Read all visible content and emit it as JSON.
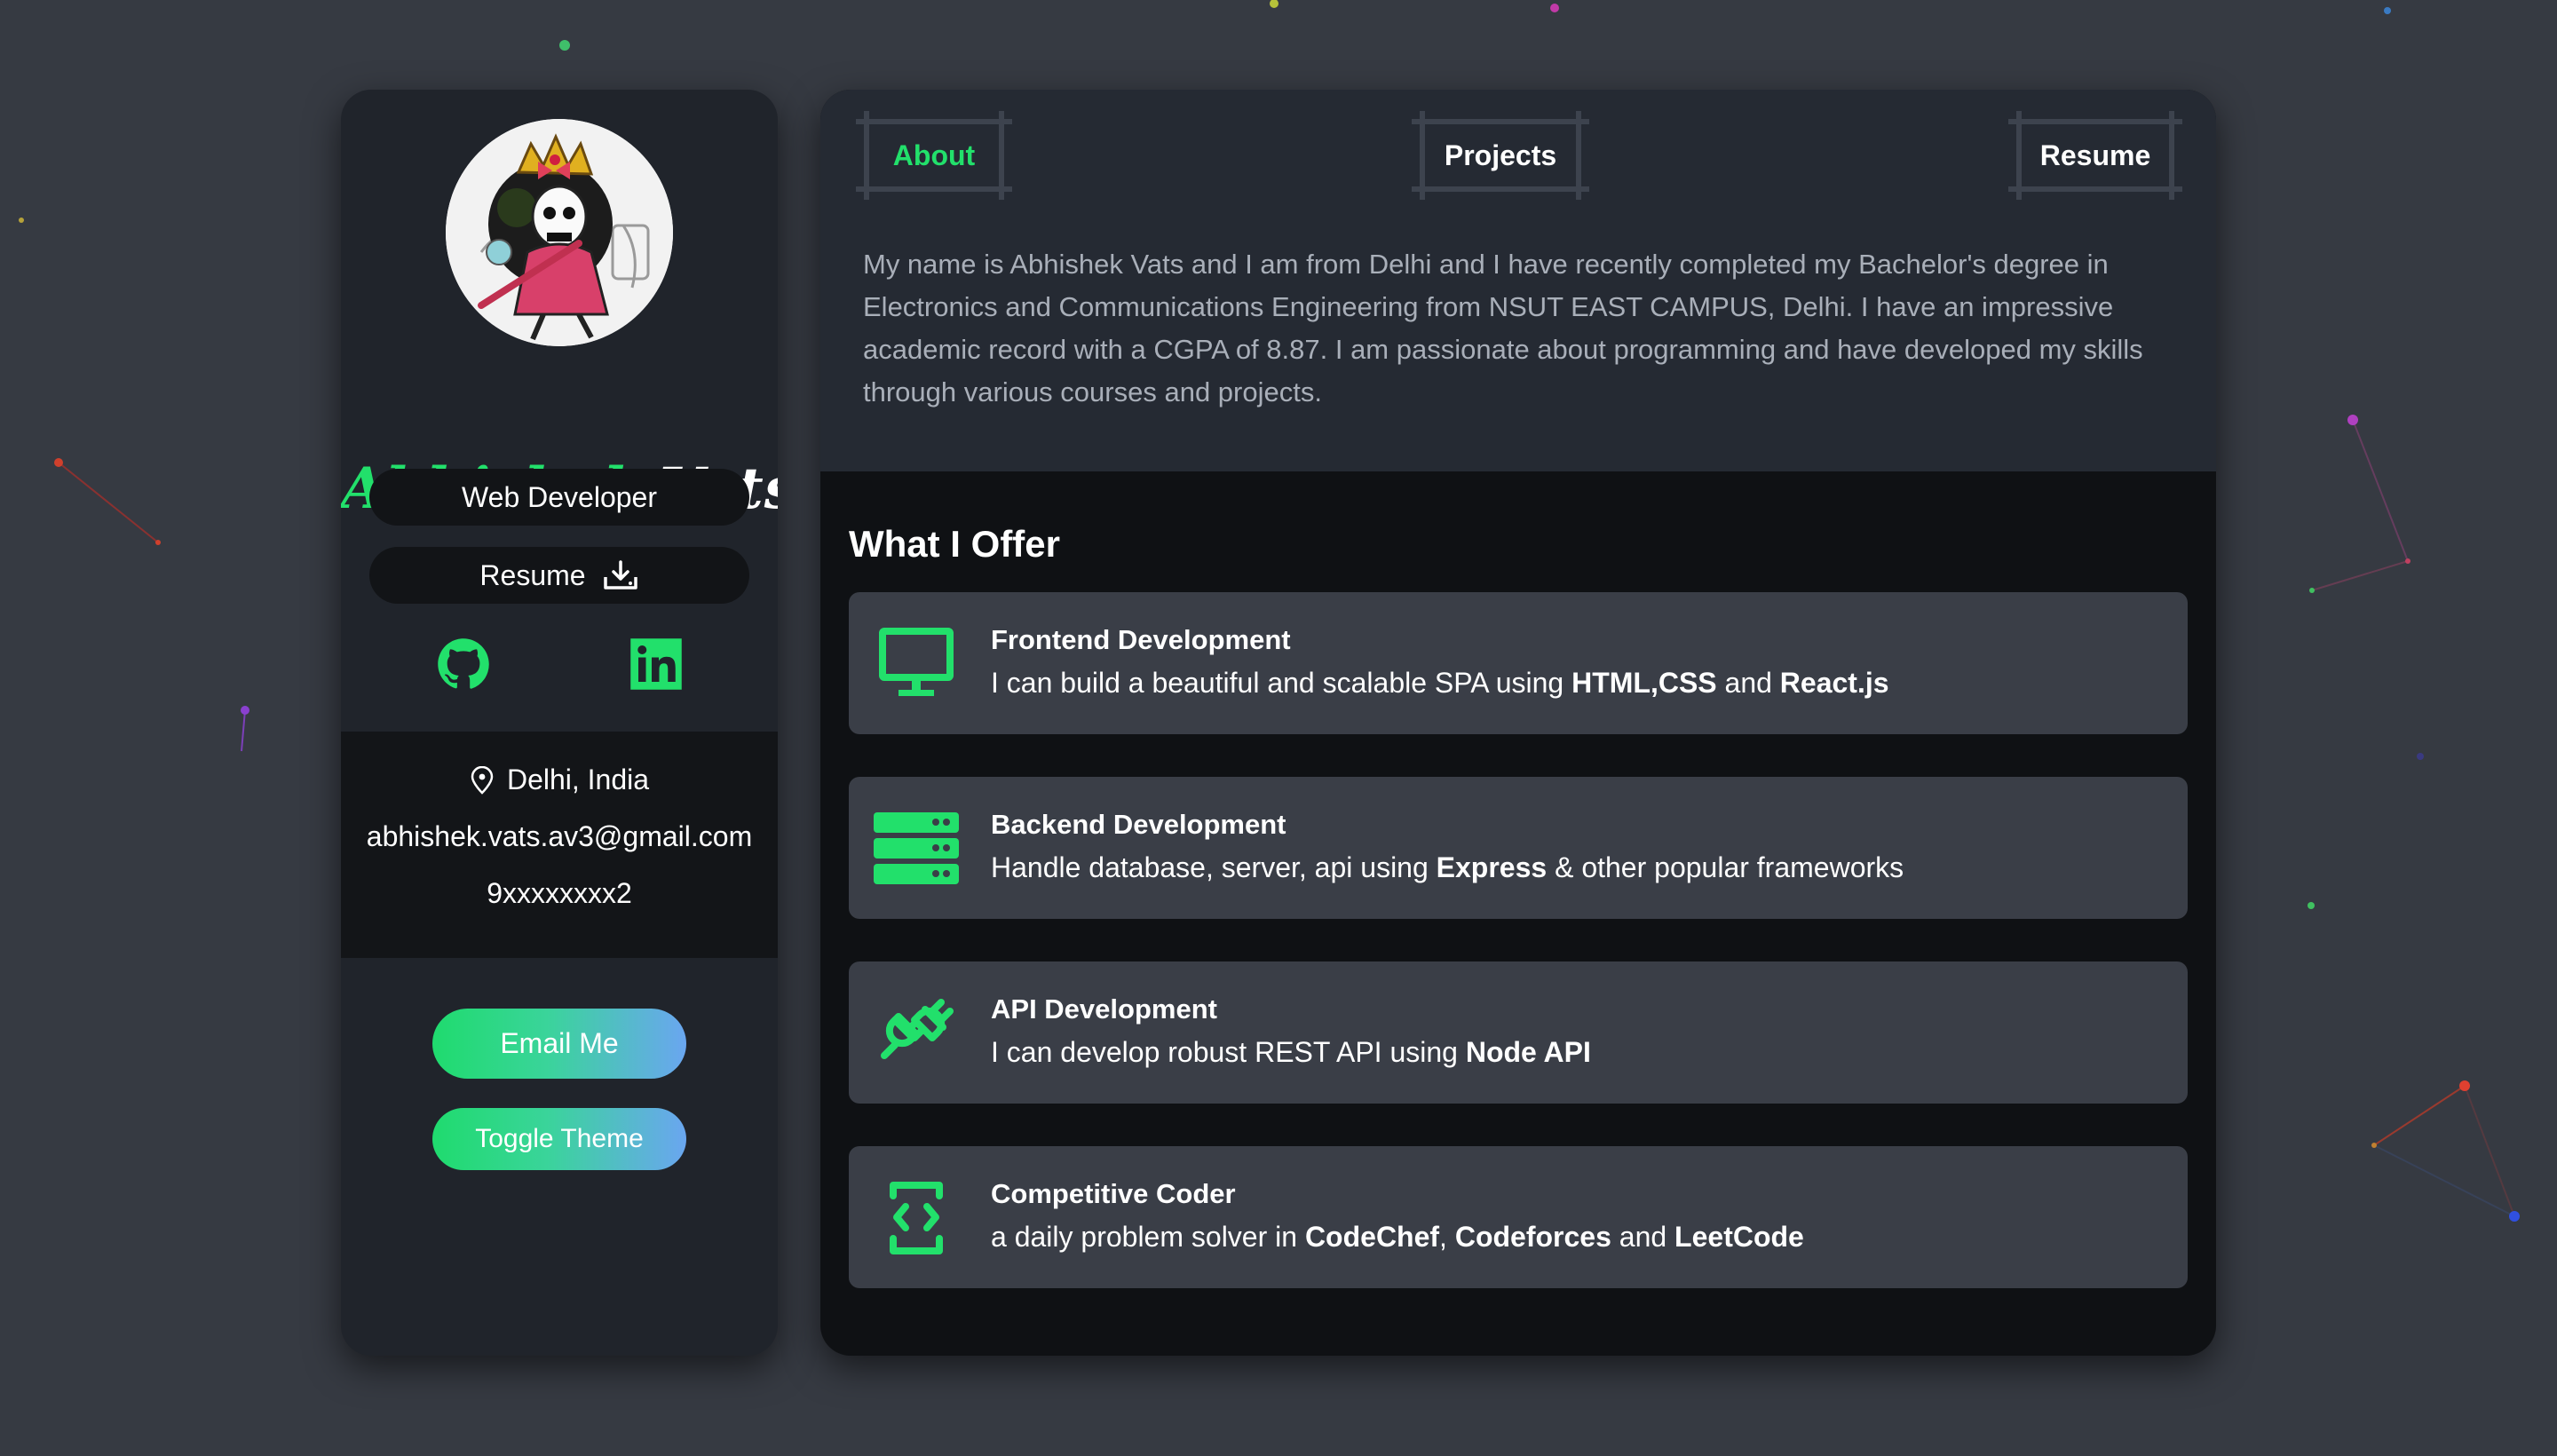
{
  "profile": {
    "first_name": "Abhishek",
    "last_name": "Vats",
    "role": "Web Developer",
    "resume_label": "Resume",
    "location": "Delhi, India",
    "email": "abhishek.vats.av3@gmail.com",
    "phone": "9xxxxxxxx2",
    "email_button": "Email Me",
    "theme_button": "Toggle Theme",
    "icons": [
      "github-icon",
      "linkedin-icon",
      "download-icon",
      "location-pin-icon"
    ]
  },
  "tabs": [
    {
      "label": "About",
      "active": true
    },
    {
      "label": "Projects",
      "active": false
    },
    {
      "label": "Resume",
      "active": false
    }
  ],
  "about_text": "My name is Abhishek Vats and I am from Delhi and I have recently completed my Bachelor's degree in Electronics and Communications Engineering from NSUT EAST CAMPUS, Delhi. I have an impressive academic record with a CGPA of 8.87. I am passionate about programming and have developed my skills through various courses and projects.",
  "offer": {
    "title": "What I Offer",
    "items": [
      {
        "icon": "monitor-icon",
        "title": "Frontend Development",
        "parts": [
          {
            "text": "I can build a beautiful and scalable SPA using ",
            "bold": false
          },
          {
            "text": "HTML,CSS",
            "bold": true
          },
          {
            "text": " and ",
            "bold": false
          },
          {
            "text": "React.js",
            "bold": true
          }
        ]
      },
      {
        "icon": "server-icon",
        "title": "Backend Development",
        "parts": [
          {
            "text": "Handle database, server, api using ",
            "bold": false
          },
          {
            "text": "Express",
            "bold": true
          },
          {
            "text": " & other popular frameworks",
            "bold": false
          }
        ]
      },
      {
        "icon": "plug-icon",
        "title": "API Development",
        "parts": [
          {
            "text": "I can develop robust REST API using ",
            "bold": false
          },
          {
            "text": "Node API",
            "bold": true
          }
        ]
      },
      {
        "icon": "code-device-icon",
        "title": "Competitive Coder",
        "parts": [
          {
            "text": "a daily problem solver in ",
            "bold": false
          },
          {
            "text": "CodeChef",
            "bold": true
          },
          {
            "text": ", ",
            "bold": false
          },
          {
            "text": "Codeforces",
            "bold": true
          },
          {
            "text": " and ",
            "bold": false
          },
          {
            "text": "LeetCode",
            "bold": true
          }
        ]
      }
    ]
  },
  "colors": {
    "accent": "#22e06b",
    "background": "#363a42",
    "card": "#20242b",
    "panel_top": "#252a33",
    "offer_card": "#3a3e47"
  }
}
